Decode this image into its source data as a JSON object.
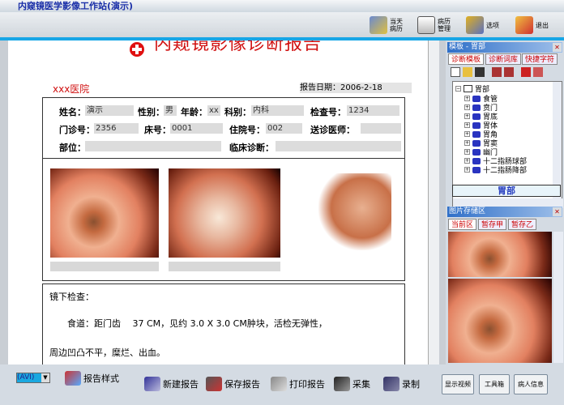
{
  "app": {
    "title": "内窥镜医学影像工作站(演示)"
  },
  "toolbar": {
    "today": "当天\n病历",
    "records": "病历\n管理",
    "options": "选项",
    "exit": "退出"
  },
  "report": {
    "title": "内窥镜影像诊断报告",
    "hospital": "xxx医院",
    "date_label": "报告日期：",
    "date": "2006-2-18",
    "fields": {
      "name_label": "姓名：",
      "name": "演示",
      "sex_label": "性别：",
      "sex": "男",
      "age_label": "年龄：",
      "age": "xx",
      "dept_label": "科别：",
      "dept": "内科",
      "exam_no_label": "检查号：",
      "exam_no": "1234",
      "outpatient_label": "门诊号：",
      "outpatient": "2356",
      "bed_label": "床号：",
      "bed": "0001",
      "inpatient_label": "住院号：",
      "inpatient": "002",
      "doctor_label": "送诊医师：",
      "doctor": "",
      "site_label": "部位：",
      "site": "",
      "clinical_label": "临床诊断：",
      "clinical": ""
    },
    "findings_title": "镜下检查：",
    "findings_line1": "食道：距门齿　 37 CM，见约 3.0 X 3.0 CM肿块，活检无弹性，",
    "findings_line2": "周边凹凸不平，糜烂、出血。"
  },
  "template_panel": {
    "title": "模板 - 胃部",
    "tabs": [
      "诊断模板",
      "诊断词库",
      "快捷字符"
    ],
    "root": "胃部",
    "items": [
      "食管",
      "贲门",
      "胃底",
      "胃体",
      "胃角",
      "胃窦",
      "幽门",
      "十二指肠球部",
      "十二指肠降部"
    ],
    "selected": "胃部"
  },
  "image_panel": {
    "title": "图片存储区",
    "tabs": [
      "当前区",
      "暂存甲",
      "暂存乙"
    ]
  },
  "bottom": {
    "device": "(AVI)",
    "report_style": "报告样式",
    "new_report": "新建报告",
    "save_report": "保存报告",
    "print_report": "打印报告",
    "capture": "采集",
    "record": "录制",
    "show_video": "显示视频",
    "toolbox": "工具箱",
    "patient_info": "病人信息"
  }
}
